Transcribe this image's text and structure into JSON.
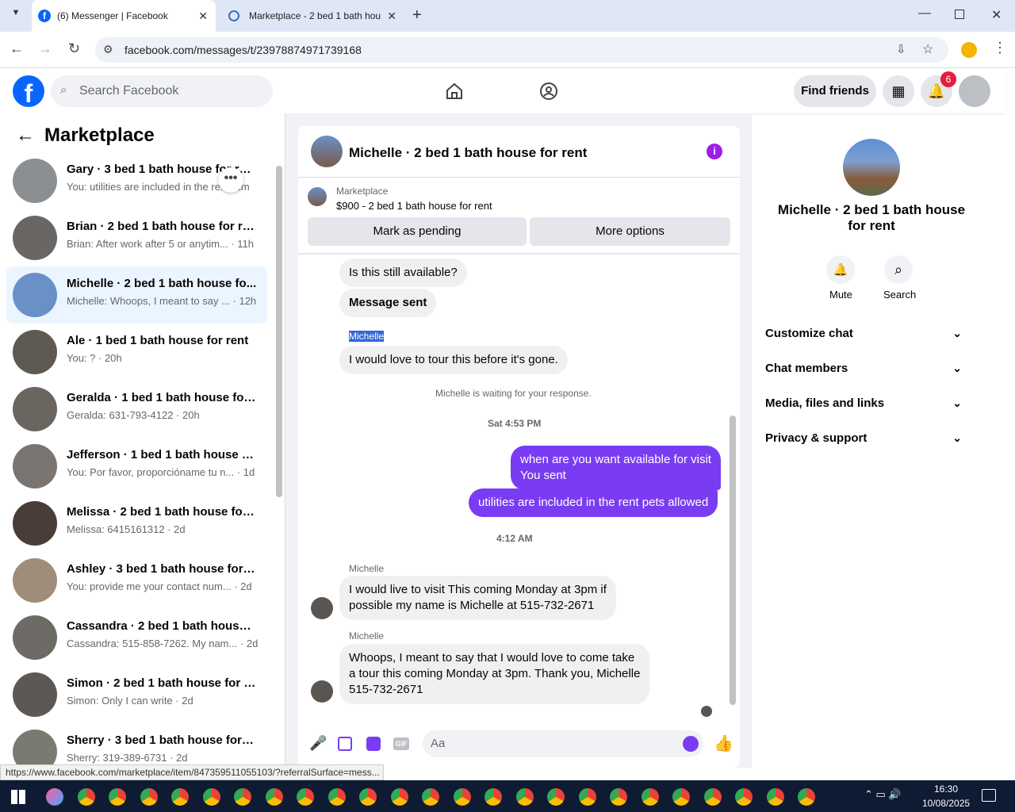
{
  "browser": {
    "tabs": [
      {
        "label": "(6) Messenger | Facebook"
      },
      {
        "label": "Marketplace - 2 bed 1 bath hou"
      }
    ],
    "url": "facebook.com/messages/t/23978874971739168"
  },
  "fb": {
    "search_placeholder": "Search Facebook",
    "find_friends": "Find friends",
    "notif_count": "6"
  },
  "left": {
    "title": "Marketplace",
    "conversations": [
      {
        "title": "Gary · 3 bed 1 bath house for rent",
        "sub": "You: utilities are included in the re... ·1m"
      },
      {
        "title": "Brian · 2 bed 1 bath house for rent",
        "sub": "Brian: After work after 5 or anytim... · 11h"
      },
      {
        "title": "Michelle · 2 bed 1 bath house fo...",
        "sub": "Michelle: Whoops, I meant to say ... · 12h"
      },
      {
        "title": "Ale · 1 bed 1 bath house for rent",
        "sub": "You: ? · 20h"
      },
      {
        "title": "Geralda · 1 bed 1 bath house for ...",
        "sub": "Geralda: 631-793-4122 · 20h"
      },
      {
        "title": "Jefferson · 1 bed 1 bath house fo...",
        "sub": "You: Por favor, proporcióname tu n... · 1d"
      },
      {
        "title": "Melissa · 2 bed 1 bath house for ...",
        "sub": "Melissa: 6415161312 · 2d"
      },
      {
        "title": "Ashley · 3 bed 1 bath house for r...",
        "sub": "You: provide me your contact num... · 2d"
      },
      {
        "title": "Cassandra · 2 bed 1 bath house f...",
        "sub": "Cassandra: 515-858-7262. My nam... · 2d"
      },
      {
        "title": "Simon · 2 bed 1 bath house for r...",
        "sub": "Simon: Only I can write · 2d"
      },
      {
        "title": "Sherry · 3 bed 1 bath house for r...",
        "sub": "Sherry: 319-389-6731 · 2d"
      }
    ]
  },
  "chat": {
    "title": "Michelle · 2 bed 1 bath house for rent",
    "mp_label": "Marketplace",
    "mp_item": "$900 - 2 bed 1 bath house for rent",
    "mark_pending": "Mark as pending",
    "more_options": "More options",
    "m1": "Is this still available?",
    "m2": "Message sent",
    "sender_hl": "Michelle",
    "m3": "I would love to tour this before it's gone.",
    "waiting": "Michelle is waiting for your response.",
    "time1": "Sat 4:53 PM",
    "o1a": "when are you want available for visit",
    "o1b": "You sent",
    "o2": "utilities are included in the rent pets allowed",
    "time2": "4:12 AM",
    "sender1": "Michelle",
    "m4a": "I would live to visit This coming Monday at 3pm if",
    "m4b": "possible  my name is Michelle at 515-732-2671",
    "sender2": "Michelle",
    "m5a": "Whoops,  I meant to say that I would love to come take",
    "m5b": "a tour this coming Monday at 3pm. Thank you, Michelle",
    "m5c": "515-732-2671",
    "input_placeholder": "Aa"
  },
  "right": {
    "name_l1": "Michelle · 2 bed 1 bath house",
    "name_l2": "for rent",
    "mute": "Mute",
    "search": "Search",
    "items": [
      "Customize chat",
      "Chat members",
      "Media, files and links",
      "Privacy & support"
    ]
  },
  "status_url": "https://www.facebook.com/marketplace/item/847359511055103/?referralSurface=mess...",
  "clock": {
    "time": "16:30",
    "date": "10/08/2025"
  },
  "colors": {
    "fb_blue": "#0866ff",
    "out_bubble": "#7a3cf2",
    "notif_red": "#e41e3f"
  }
}
